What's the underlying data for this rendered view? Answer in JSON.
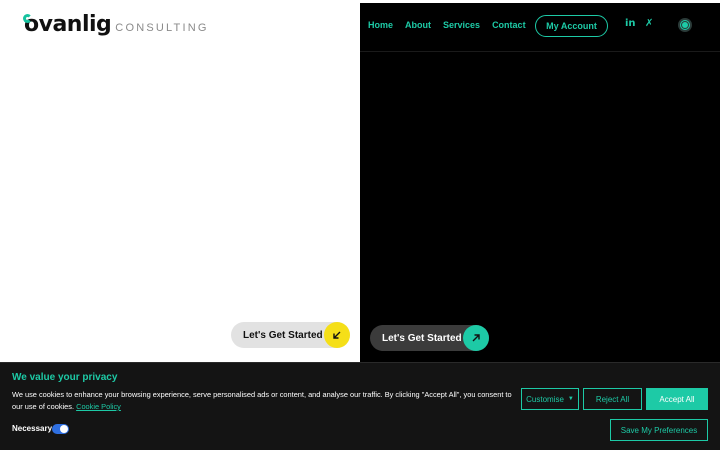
{
  "brand": {
    "name": "ovanlig",
    "sub": "CONSULTING"
  },
  "nav": {
    "items": [
      "Home",
      "About",
      "Services",
      "Contact"
    ],
    "account": "My Account"
  },
  "social": {
    "linkedin_glyph": "in",
    "xing_glyph": "✗"
  },
  "icons": {
    "linkedin": "linkedin-icon",
    "xing": "xing-icon",
    "theme": "sun-icon",
    "arrow_left": "arrow-down-left-icon",
    "arrow_right": "arrow-up-right-icon"
  },
  "cta": {
    "left_label": "Let's Get Started",
    "right_label": "Let's Get Started"
  },
  "cookie": {
    "title": "We value your privacy",
    "text": "We use cookies to enhance your browsing experience, serve personalised ads or content, and analyse our traffic. By clicking \"Accept All\", you consent to our use of cookies.",
    "link": "Cookie Policy",
    "necessary": "Necessary",
    "customise": "Customise",
    "reject": "Reject All",
    "accept": "Accept All",
    "save": "Save My Preferences"
  },
  "colors": {
    "accent": "#1dcaa6",
    "yellow": "#f5df18",
    "banner": "#141414",
    "toggle": "#2f6fe0"
  }
}
